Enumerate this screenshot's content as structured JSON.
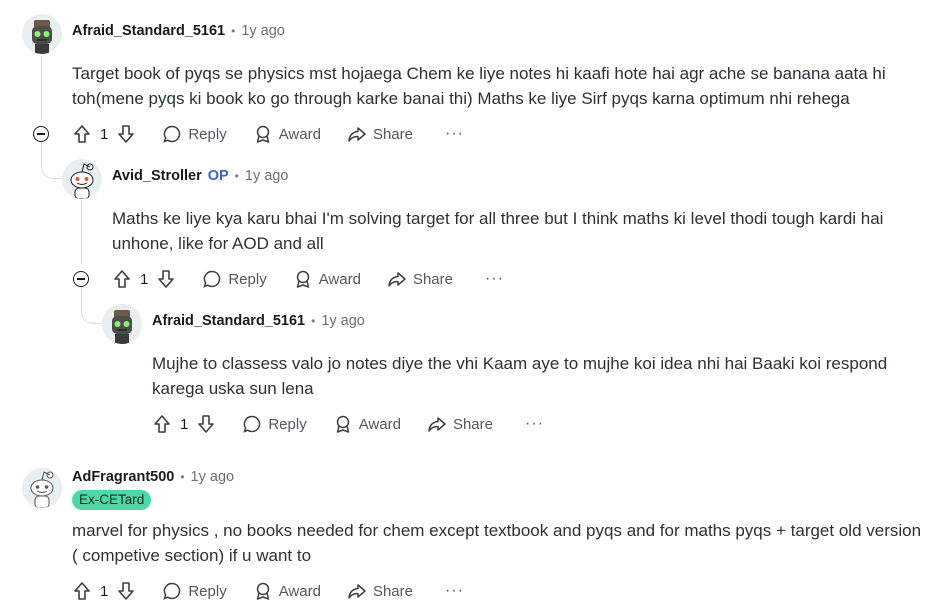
{
  "comments": [
    {
      "user": "Afraid_Standard_5161",
      "time": "1y ago",
      "text": "Target book of pyqs se physics mst hojaega Chem ke liye notes hi kaafi hote hai agr ache se banana aata hi toh(mene pyqs ki book ko go through karke banai thi) Maths ke liye Sirf pyqs karna optimum nhi rehega",
      "votes": "1"
    },
    {
      "user": "Avid_Stroller",
      "op": "OP",
      "time": "1y ago",
      "text": "Maths ke liye kya karu bhai I'm solving target for all three but I think maths ki level thodi tough kardi hai unhone, like for AOD and all",
      "votes": "1"
    },
    {
      "user": "Afraid_Standard_5161",
      "time": "1y ago",
      "text": "Mujhe to classess valo jo notes diye the vhi Kaam aye to mujhe koi idea nhi hai Baaki koi respond karega uska sun lena",
      "votes": "1"
    },
    {
      "user": "AdFragrant500",
      "time": "1y ago",
      "flair": "Ex-CETard",
      "text": "marvel for physics , no books needed for chem except textbook and pyqs and for maths pyqs + target old version ( competive section) if u want to",
      "votes": "1"
    }
  ],
  "actions": {
    "reply": "Reply",
    "award": "Award",
    "share": "Share",
    "more": "···",
    "separator": "•"
  },
  "colors": {
    "flair_bg": "#4fd8a6",
    "op": "#3f61c9",
    "thread_line": "#d9dde0"
  }
}
